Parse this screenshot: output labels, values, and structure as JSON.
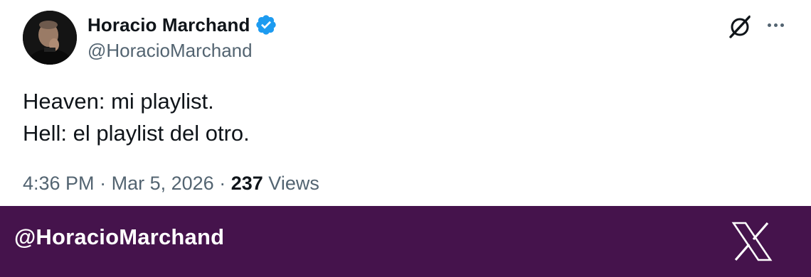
{
  "tweet": {
    "author_name": "Horacio Marchand",
    "author_handle": "@HoracioMarchand",
    "verified": true,
    "lines": [
      "Heaven: mi playlist.",
      "Hell: el playlist del otro."
    ],
    "time": "4:36 PM",
    "separator": "·",
    "date": "Mar 5, 2026",
    "views_count": "237",
    "views_label": "Views"
  },
  "footer": {
    "handle": "@HoracioMarchand",
    "logo": "x-logo-icon"
  },
  "icons": {
    "verified": "verified-badge-icon",
    "grok": "grok-icon",
    "more": "more-options-icon"
  },
  "colors": {
    "verified_blue": "#1d9bf0",
    "text_primary": "#0f1419",
    "text_secondary": "#536471",
    "footer_bg": "#45134c"
  }
}
